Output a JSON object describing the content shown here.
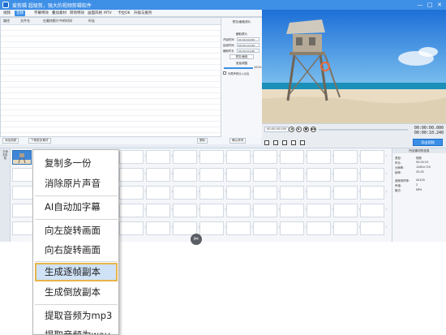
{
  "window": {
    "title": "爱剪辑  超级剪，强大的视频剪辑软件",
    "controls": [
      "—",
      "□",
      "✕"
    ]
  },
  "menu": {
    "items": [
      "视频",
      "音频",
      "字幕特效",
      "叠加素材",
      "转场特效",
      "画面风格",
      "MTV",
      "卡拉OK",
      "升级与服务"
    ],
    "active_index": 1
  },
  "media_list": {
    "columns": [
      "路径",
      "文件名",
      "在最终影片中的时间",
      "时长"
    ],
    "add_video_button": "添加视频",
    "download_button": "下载更多素材",
    "delete_button": "删除"
  },
  "settings_panel": {
    "section_title": "预览/截取原片",
    "trim_title": "截取原片",
    "start_time_label": "开始时间",
    "start_time": "00:00:00.000",
    "end_time_label": "结束时间",
    "end_time": "00:00:10.240",
    "duration_label": "截取时长",
    "duration": "00:00:10.240",
    "preview_button": "预览/截取",
    "volume_title": "音量调整",
    "volume_value": "100%",
    "volume_level": 1.0,
    "checkbox_label": "头尾声音淡入淡出",
    "confirm_button": "确认修改"
  },
  "player": {
    "time_input": "00:00:00.000",
    "controls": [
      "◀",
      "▶",
      "■",
      "▶▶",
      "⤢"
    ],
    "current_time": "00:00:00.000",
    "total_time": "00:00:10.240",
    "export_button": "导出视频",
    "progress": 0.0
  },
  "timeline": {
    "track_label": "已添加片段",
    "clip_count": 1
  },
  "properties": {
    "title": "所选素材的信息",
    "rows": [
      {
        "label": "类型：",
        "value": "视频"
      },
      {
        "label": "时长：",
        "value": "00:00:10"
      },
      {
        "label": "分辨率：",
        "value": "1280×720"
      },
      {
        "label": "帧率：",
        "value": "25.00"
      },
      {
        "label": "音频采样率：",
        "value": "44100"
      },
      {
        "label": "声道：",
        "value": "2"
      },
      {
        "label": "格式：",
        "value": "MP4"
      }
    ]
  },
  "context_menu": {
    "items": [
      "复制多一份",
      "消除原片声音",
      "AI自动加字幕",
      "向左旋转画面",
      "向右旋转画面",
      "生成逐帧副本",
      "生成倒放副本",
      "提取音频为mp3",
      "提取音频为wav"
    ],
    "selected_index": 5
  }
}
